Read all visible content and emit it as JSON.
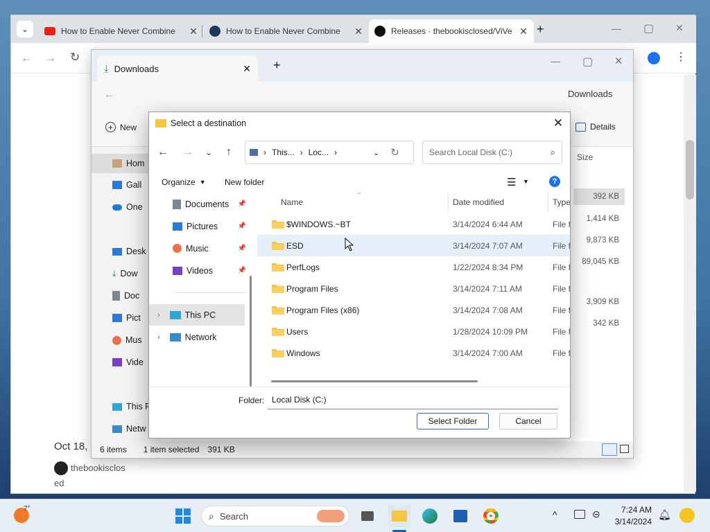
{
  "chrome": {
    "tabs": [
      {
        "label": "How to Enable Never Combine"
      },
      {
        "label": "How to Enable Never Combine"
      },
      {
        "label": "Releases · thebookisclosed/ViVe"
      }
    ],
    "new_tab": "+",
    "minimize": "—",
    "maximize": "▢",
    "close": "✕"
  },
  "page_bg": {
    "date_fragment": "Oct 18,",
    "author_line1": "thebookisclos",
    "author_line2": "ed"
  },
  "explorer": {
    "tab_title": "Downloads",
    "new_label": "New",
    "details_label": "Details",
    "breadcrumb_end": "Downloads",
    "size_header": "Size",
    "sidebar": [
      "Hom",
      "Gall",
      "One",
      "Desk",
      "Dow",
      "Doc",
      "Pict",
      "Mus",
      "Vide",
      "This P",
      "Netw"
    ],
    "sizes": [
      "392 KB",
      "1,414 KB",
      "9,873 KB",
      "89,045 KB",
      "3,909 KB",
      "342 KB"
    ],
    "status": {
      "count": "6 items",
      "selected": "1 item selected",
      "size": "391 KB"
    }
  },
  "dialog": {
    "title": "Select a destination",
    "address": {
      "part1": "This...",
      "part2": "Loc..."
    },
    "search_placeholder": "Search Local Disk (C:)",
    "organize": "Organize",
    "new_folder": "New folder",
    "help": "?",
    "tree": [
      {
        "label": "Documents",
        "icon": "document-icon"
      },
      {
        "label": "Pictures",
        "icon": "pictures-icon"
      },
      {
        "label": "Music",
        "icon": "music-icon"
      },
      {
        "label": "Videos",
        "icon": "videos-icon"
      }
    ],
    "tree_root": [
      {
        "label": "This PC",
        "icon": "pc-icon"
      },
      {
        "label": "Network",
        "icon": "network-icon"
      }
    ],
    "columns": {
      "name": "Name",
      "date": "Date modified",
      "type": "Type"
    },
    "rows": [
      {
        "name": "$WINDOWS.~BT",
        "date": "3/14/2024 6:44 AM",
        "type": "File fo"
      },
      {
        "name": "ESD",
        "date": "3/14/2024 7:07 AM",
        "type": "File fo"
      },
      {
        "name": "PerfLogs",
        "date": "1/22/2024 8:34 PM",
        "type": "File fo"
      },
      {
        "name": "Program Files",
        "date": "3/14/2024 7:11 AM",
        "type": "File fo"
      },
      {
        "name": "Program Files (x86)",
        "date": "3/14/2024 7:08 AM",
        "type": "File fo"
      },
      {
        "name": "Users",
        "date": "1/28/2024 10:09 PM",
        "type": "File fo"
      },
      {
        "name": "Windows",
        "date": "3/14/2024 7:00 AM",
        "type": "File fo"
      }
    ],
    "folder_label": "Folder:",
    "folder_value": "Local Disk (C:)",
    "select_button": "Select Folder",
    "cancel_button": "Cancel"
  },
  "taskbar": {
    "weather": "7°",
    "search": "Search",
    "time": "7:24 AM",
    "date": "3/14/2024"
  },
  "colors": {
    "accent": "#0067c0",
    "folder": "#f4c542",
    "folder_dark": "#e0a820"
  }
}
